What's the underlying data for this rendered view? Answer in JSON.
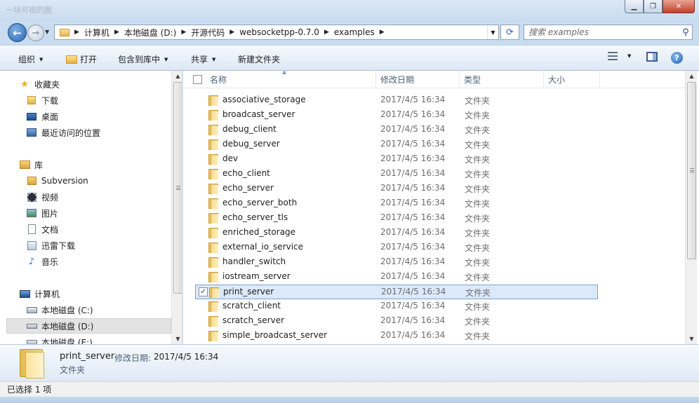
{
  "window": {
    "title": "一块可视的图"
  },
  "address_bar": {
    "breadcrumbs": [
      "计算机",
      "本地磁盘 (D:)",
      "开源代码",
      "websocketpp-0.7.0",
      "examples"
    ]
  },
  "search": {
    "placeholder": "搜索 examples"
  },
  "toolbar": {
    "organize": "组织",
    "open": "打开",
    "include_in_library": "包含到库中",
    "share": "共享",
    "new_folder": "新建文件夹"
  },
  "nav_pane": {
    "favorites": {
      "label": "收藏夹",
      "items": [
        "下载",
        "桌面",
        "最近访问的位置"
      ]
    },
    "libraries": {
      "label": "库",
      "items": [
        "Subversion",
        "视频",
        "图片",
        "文档",
        "迅雷下载",
        "音乐"
      ]
    },
    "computer": {
      "label": "计算机",
      "items": [
        "本地磁盘 (C:)",
        "本地磁盘 (D:)",
        "本地磁盘 (E:)"
      ]
    },
    "selected": "本地磁盘 (D:)"
  },
  "columns": {
    "name": "名称",
    "date": "修改日期",
    "type": "类型",
    "size": "大小"
  },
  "files": [
    {
      "name": "associative_storage",
      "date": "2017/4/5 16:34",
      "type": "文件夹"
    },
    {
      "name": "broadcast_server",
      "date": "2017/4/5 16:34",
      "type": "文件夹"
    },
    {
      "name": "debug_client",
      "date": "2017/4/5 16:34",
      "type": "文件夹"
    },
    {
      "name": "debug_server",
      "date": "2017/4/5 16:34",
      "type": "文件夹"
    },
    {
      "name": "dev",
      "date": "2017/4/5 16:34",
      "type": "文件夹"
    },
    {
      "name": "echo_client",
      "date": "2017/4/5 16:34",
      "type": "文件夹"
    },
    {
      "name": "echo_server",
      "date": "2017/4/5 16:34",
      "type": "文件夹"
    },
    {
      "name": "echo_server_both",
      "date": "2017/4/5 16:34",
      "type": "文件夹"
    },
    {
      "name": "echo_server_tls",
      "date": "2017/4/5 16:34",
      "type": "文件夹"
    },
    {
      "name": "enriched_storage",
      "date": "2017/4/5 16:34",
      "type": "文件夹"
    },
    {
      "name": "external_io_service",
      "date": "2017/4/5 16:34",
      "type": "文件夹"
    },
    {
      "name": "handler_switch",
      "date": "2017/4/5 16:34",
      "type": "文件夹"
    },
    {
      "name": "iostream_server",
      "date": "2017/4/5 16:34",
      "type": "文件夹"
    },
    {
      "name": "print_server",
      "date": "2017/4/5 16:34",
      "type": "文件夹",
      "selected": true
    },
    {
      "name": "scratch_client",
      "date": "2017/4/5 16:34",
      "type": "文件夹"
    },
    {
      "name": "scratch_server",
      "date": "2017/4/5 16:34",
      "type": "文件夹"
    },
    {
      "name": "simple_broadcast_server",
      "date": "2017/4/5 16:34",
      "type": "文件夹"
    }
  ],
  "details": {
    "name": "print_server",
    "date_label": "修改日期:",
    "date_value": "2017/4/5 16:34",
    "type": "文件夹"
  },
  "status": {
    "text": "已选择 1 项"
  },
  "colors": {
    "selection": "#dbe9fb",
    "selection_border": "#7da2ce",
    "frame": "#c9dcf0"
  }
}
